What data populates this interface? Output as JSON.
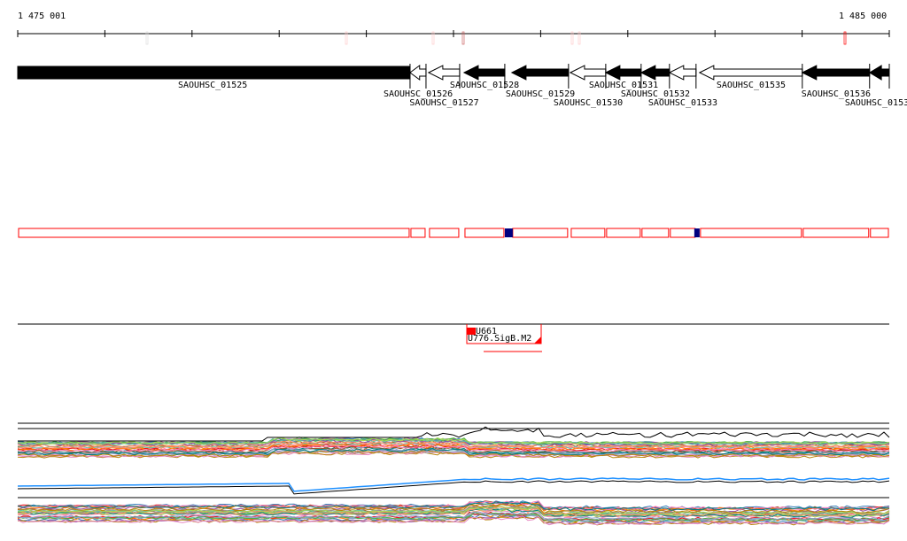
{
  "ruler": {
    "start_label": "1 475 001",
    "end_label": "1 485 000",
    "start": 1475001,
    "end": 1485000
  },
  "genes": [
    {
      "name": "SAOUHSC_01525",
      "start": 1475001,
      "end": 1479502,
      "filled": true,
      "arrow": "none"
    },
    {
      "name": "SAOUHSC_01526",
      "start": 1479502,
      "end": 1479685,
      "filled": false,
      "arrow": "left"
    },
    {
      "name": "SAOUHSC_01527",
      "start": 1479715,
      "end": 1480071,
      "filled": false,
      "arrow": "left"
    },
    {
      "name": "SAOUHSC_01528",
      "start": 1480122,
      "end": 1480589,
      "filled": true,
      "arrow": "left"
    },
    {
      "name": "SAOUHSC_01529",
      "start": 1480670,
      "end": 1481320,
      "filled": true,
      "arrow": "left"
    },
    {
      "name": "SAOUHSC_01530",
      "start": 1481341,
      "end": 1481747,
      "filled": false,
      "arrow": "left"
    },
    {
      "name": "SAOUHSC_01531",
      "start": 1481747,
      "end": 1482153,
      "filled": true,
      "arrow": "left"
    },
    {
      "name": "SAOUHSC_01532",
      "start": 1482153,
      "end": 1482478,
      "filled": true,
      "arrow": "left"
    },
    {
      "name": "SAOUHSC_01533",
      "start": 1482478,
      "end": 1482783,
      "filled": false,
      "arrow": "left"
    },
    {
      "name": "SAOUHSC_01535",
      "start": 1482824,
      "end": 1484002,
      "filled": false,
      "arrow": "left"
    },
    {
      "name": "SAOUHSC_01536",
      "start": 1484002,
      "end": 1484774,
      "filled": true,
      "arrow": "left"
    },
    {
      "name": "SAOUHSC_0153",
      "start": 1484774,
      "end": 1485000,
      "filled": true,
      "arrow": "left"
    }
  ],
  "feature_markers": [
    {
      "start": 1480589,
      "end": 1480680
    },
    {
      "start": 1482763,
      "end": 1482824
    }
  ],
  "regulatory": {
    "label1": "U661",
    "label2": "U776.SigB.M2"
  },
  "colors": {
    "gene_box": "#ff0000",
    "marker": "#000080",
    "accent": "#ff0000"
  }
}
